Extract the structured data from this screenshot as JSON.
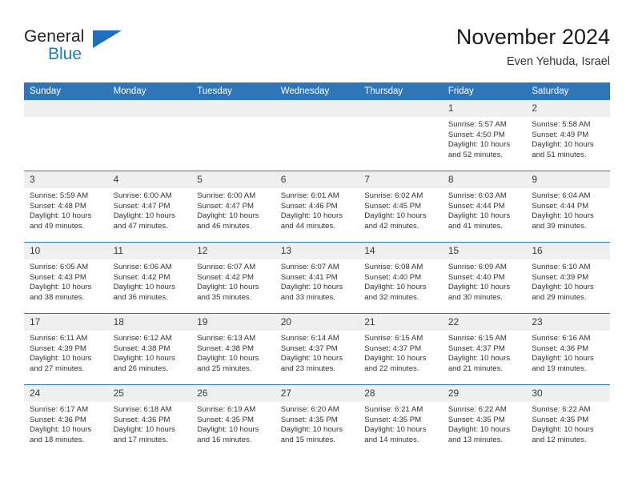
{
  "brand": {
    "name_part1": "General",
    "name_part2": "Blue",
    "triangle_icon": "triangle-icon",
    "colors": {
      "dark": "#231f20",
      "blue": "#1f7ac4",
      "header_blue": "#2f76b8",
      "daynum_band": "#efefef"
    }
  },
  "header": {
    "month_year": "November 2024",
    "location": "Even Yehuda, Israel"
  },
  "calendar": {
    "day_headers": [
      "Sunday",
      "Monday",
      "Tuesday",
      "Wednesday",
      "Thursday",
      "Friday",
      "Saturday"
    ],
    "weeks": [
      [
        {
          "day": "",
          "empty": true,
          "sunrise": "",
          "sunset": "",
          "daylight_line1": "",
          "daylight_line2": ""
        },
        {
          "day": "",
          "empty": true,
          "sunrise": "",
          "sunset": "",
          "daylight_line1": "",
          "daylight_line2": ""
        },
        {
          "day": "",
          "empty": true,
          "sunrise": "",
          "sunset": "",
          "daylight_line1": "",
          "daylight_line2": ""
        },
        {
          "day": "",
          "empty": true,
          "sunrise": "",
          "sunset": "",
          "daylight_line1": "",
          "daylight_line2": ""
        },
        {
          "day": "",
          "empty": true,
          "sunrise": "",
          "sunset": "",
          "daylight_line1": "",
          "daylight_line2": ""
        },
        {
          "day": "1",
          "empty": false,
          "sunrise": "Sunrise: 5:57 AM",
          "sunset": "Sunset: 4:50 PM",
          "daylight_line1": "Daylight: 10 hours",
          "daylight_line2": "and 52 minutes."
        },
        {
          "day": "2",
          "empty": false,
          "sunrise": "Sunrise: 5:58 AM",
          "sunset": "Sunset: 4:49 PM",
          "daylight_line1": "Daylight: 10 hours",
          "daylight_line2": "and 51 minutes."
        }
      ],
      [
        {
          "day": "3",
          "empty": false,
          "sunrise": "Sunrise: 5:59 AM",
          "sunset": "Sunset: 4:48 PM",
          "daylight_line1": "Daylight: 10 hours",
          "daylight_line2": "and 49 minutes."
        },
        {
          "day": "4",
          "empty": false,
          "sunrise": "Sunrise: 6:00 AM",
          "sunset": "Sunset: 4:47 PM",
          "daylight_line1": "Daylight: 10 hours",
          "daylight_line2": "and 47 minutes."
        },
        {
          "day": "5",
          "empty": false,
          "sunrise": "Sunrise: 6:00 AM",
          "sunset": "Sunset: 4:47 PM",
          "daylight_line1": "Daylight: 10 hours",
          "daylight_line2": "and 46 minutes."
        },
        {
          "day": "6",
          "empty": false,
          "sunrise": "Sunrise: 6:01 AM",
          "sunset": "Sunset: 4:46 PM",
          "daylight_line1": "Daylight: 10 hours",
          "daylight_line2": "and 44 minutes."
        },
        {
          "day": "7",
          "empty": false,
          "sunrise": "Sunrise: 6:02 AM",
          "sunset": "Sunset: 4:45 PM",
          "daylight_line1": "Daylight: 10 hours",
          "daylight_line2": "and 42 minutes."
        },
        {
          "day": "8",
          "empty": false,
          "sunrise": "Sunrise: 6:03 AM",
          "sunset": "Sunset: 4:44 PM",
          "daylight_line1": "Daylight: 10 hours",
          "daylight_line2": "and 41 minutes."
        },
        {
          "day": "9",
          "empty": false,
          "sunrise": "Sunrise: 6:04 AM",
          "sunset": "Sunset: 4:44 PM",
          "daylight_line1": "Daylight: 10 hours",
          "daylight_line2": "and 39 minutes."
        }
      ],
      [
        {
          "day": "10",
          "empty": false,
          "sunrise": "Sunrise: 6:05 AM",
          "sunset": "Sunset: 4:43 PM",
          "daylight_line1": "Daylight: 10 hours",
          "daylight_line2": "and 38 minutes."
        },
        {
          "day": "11",
          "empty": false,
          "sunrise": "Sunrise: 6:06 AM",
          "sunset": "Sunset: 4:42 PM",
          "daylight_line1": "Daylight: 10 hours",
          "daylight_line2": "and 36 minutes."
        },
        {
          "day": "12",
          "empty": false,
          "sunrise": "Sunrise: 6:07 AM",
          "sunset": "Sunset: 4:42 PM",
          "daylight_line1": "Daylight: 10 hours",
          "daylight_line2": "and 35 minutes."
        },
        {
          "day": "13",
          "empty": false,
          "sunrise": "Sunrise: 6:07 AM",
          "sunset": "Sunset: 4:41 PM",
          "daylight_line1": "Daylight: 10 hours",
          "daylight_line2": "and 33 minutes."
        },
        {
          "day": "14",
          "empty": false,
          "sunrise": "Sunrise: 6:08 AM",
          "sunset": "Sunset: 4:40 PM",
          "daylight_line1": "Daylight: 10 hours",
          "daylight_line2": "and 32 minutes."
        },
        {
          "day": "15",
          "empty": false,
          "sunrise": "Sunrise: 6:09 AM",
          "sunset": "Sunset: 4:40 PM",
          "daylight_line1": "Daylight: 10 hours",
          "daylight_line2": "and 30 minutes."
        },
        {
          "day": "16",
          "empty": false,
          "sunrise": "Sunrise: 6:10 AM",
          "sunset": "Sunset: 4:39 PM",
          "daylight_line1": "Daylight: 10 hours",
          "daylight_line2": "and 29 minutes."
        }
      ],
      [
        {
          "day": "17",
          "empty": false,
          "sunrise": "Sunrise: 6:11 AM",
          "sunset": "Sunset: 4:39 PM",
          "daylight_line1": "Daylight: 10 hours",
          "daylight_line2": "and 27 minutes."
        },
        {
          "day": "18",
          "empty": false,
          "sunrise": "Sunrise: 6:12 AM",
          "sunset": "Sunset: 4:38 PM",
          "daylight_line1": "Daylight: 10 hours",
          "daylight_line2": "and 26 minutes."
        },
        {
          "day": "19",
          "empty": false,
          "sunrise": "Sunrise: 6:13 AM",
          "sunset": "Sunset: 4:38 PM",
          "daylight_line1": "Daylight: 10 hours",
          "daylight_line2": "and 25 minutes."
        },
        {
          "day": "20",
          "empty": false,
          "sunrise": "Sunrise: 6:14 AM",
          "sunset": "Sunset: 4:37 PM",
          "daylight_line1": "Daylight: 10 hours",
          "daylight_line2": "and 23 minutes."
        },
        {
          "day": "21",
          "empty": false,
          "sunrise": "Sunrise: 6:15 AM",
          "sunset": "Sunset: 4:37 PM",
          "daylight_line1": "Daylight: 10 hours",
          "daylight_line2": "and 22 minutes."
        },
        {
          "day": "22",
          "empty": false,
          "sunrise": "Sunrise: 6:15 AM",
          "sunset": "Sunset: 4:37 PM",
          "daylight_line1": "Daylight: 10 hours",
          "daylight_line2": "and 21 minutes."
        },
        {
          "day": "23",
          "empty": false,
          "sunrise": "Sunrise: 6:16 AM",
          "sunset": "Sunset: 4:36 PM",
          "daylight_line1": "Daylight: 10 hours",
          "daylight_line2": "and 19 minutes."
        }
      ],
      [
        {
          "day": "24",
          "empty": false,
          "sunrise": "Sunrise: 6:17 AM",
          "sunset": "Sunset: 4:36 PM",
          "daylight_line1": "Daylight: 10 hours",
          "daylight_line2": "and 18 minutes."
        },
        {
          "day": "25",
          "empty": false,
          "sunrise": "Sunrise: 6:18 AM",
          "sunset": "Sunset: 4:36 PM",
          "daylight_line1": "Daylight: 10 hours",
          "daylight_line2": "and 17 minutes."
        },
        {
          "day": "26",
          "empty": false,
          "sunrise": "Sunrise: 6:19 AM",
          "sunset": "Sunset: 4:35 PM",
          "daylight_line1": "Daylight: 10 hours",
          "daylight_line2": "and 16 minutes."
        },
        {
          "day": "27",
          "empty": false,
          "sunrise": "Sunrise: 6:20 AM",
          "sunset": "Sunset: 4:35 PM",
          "daylight_line1": "Daylight: 10 hours",
          "daylight_line2": "and 15 minutes."
        },
        {
          "day": "28",
          "empty": false,
          "sunrise": "Sunrise: 6:21 AM",
          "sunset": "Sunset: 4:35 PM",
          "daylight_line1": "Daylight: 10 hours",
          "daylight_line2": "and 14 minutes."
        },
        {
          "day": "29",
          "empty": false,
          "sunrise": "Sunrise: 6:22 AM",
          "sunset": "Sunset: 4:35 PM",
          "daylight_line1": "Daylight: 10 hours",
          "daylight_line2": "and 13 minutes."
        },
        {
          "day": "30",
          "empty": false,
          "sunrise": "Sunrise: 6:22 AM",
          "sunset": "Sunset: 4:35 PM",
          "daylight_line1": "Daylight: 10 hours",
          "daylight_line2": "and 12 minutes."
        }
      ]
    ]
  }
}
